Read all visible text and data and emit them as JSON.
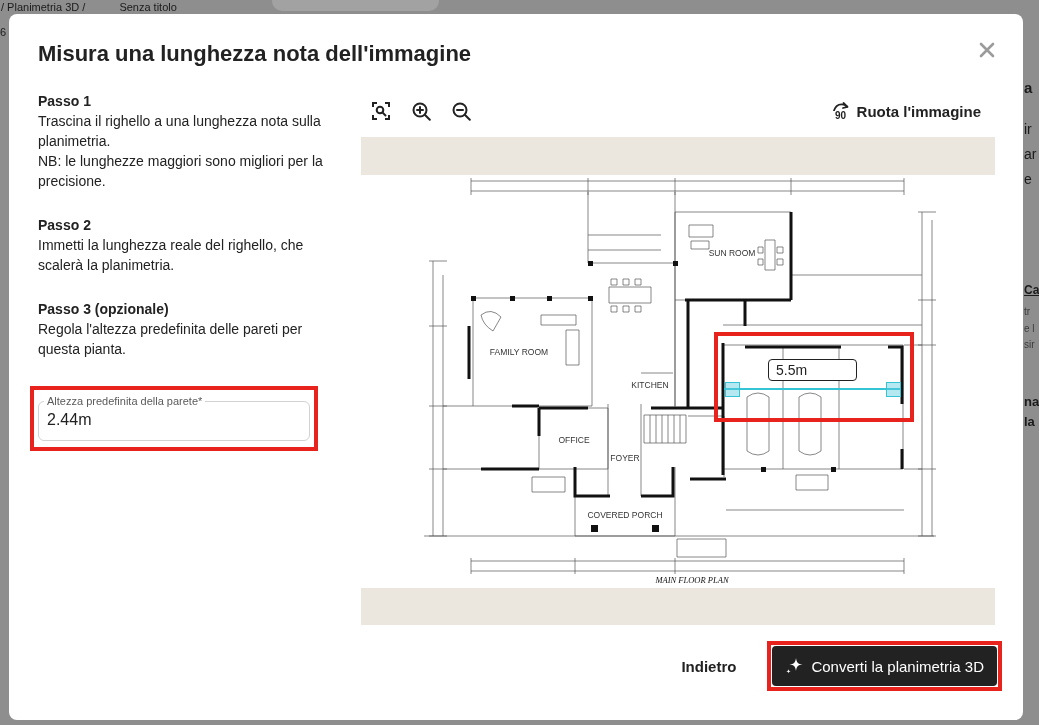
{
  "page_backdrop": {
    "breadcrumb": "/ Planimetria 3D /",
    "document_title": "Senza titolo",
    "left_fragment": "6",
    "right_fragments": [
      {
        "kind": "title",
        "lines": [
          "a"
        ]
      },
      {
        "kind": "body",
        "lines": [
          "ir",
          "ar",
          "e"
        ]
      },
      {
        "kind": "link",
        "lines": [
          "Ca"
        ]
      },
      {
        "kind": "caption",
        "lines": [
          "tr",
          "e l",
          "sir"
        ]
      },
      {
        "kind": "label",
        "lines": [
          "na",
          "la"
        ]
      }
    ]
  },
  "dialog": {
    "title": "Misura una lunghezza nota dell'immagine",
    "steps": [
      {
        "heading": "Passo 1",
        "paragraphs": [
          "Trascina il righello a una lunghezza nota sulla planimetria.",
          "NB: le lunghezze maggiori sono migliori per la precisione."
        ]
      },
      {
        "heading": "Passo 2",
        "paragraphs": [
          "Immetti la lunghezza reale del righello, che scalerà la planimetria."
        ]
      },
      {
        "heading": "Passo 3 (opzionale)",
        "paragraphs": [
          "Regola l'altezza predefinita delle pareti per questa pianta."
        ]
      }
    ],
    "wall_height_field": {
      "label": "Altezza predefinita della parete*",
      "value": "2.44m",
      "highlighted": true
    },
    "toolbar": {
      "tools": [
        {
          "kind": "fit"
        },
        {
          "kind": "zoom_in"
        },
        {
          "kind": "zoom_out"
        }
      ],
      "rotate_button": {
        "label": "Ruota l'immagine",
        "degrees": "90"
      }
    },
    "floor_plan": {
      "caption": "MAIN FLOOR PLAN",
      "room_labels": [
        "FAMILY ROOM",
        "KITCHEN",
        "OFFICE",
        "FOYER",
        "SUN ROOM",
        "COVERED PORCH"
      ]
    },
    "ruler": {
      "length": "5.5m",
      "highlighted": true
    },
    "buttons": [
      {
        "kind": "text",
        "label": "Indietro",
        "highlighted": false
      },
      {
        "kind": "primary",
        "label": "Converti la planimetria 3D",
        "highlighted": true
      }
    ]
  }
}
